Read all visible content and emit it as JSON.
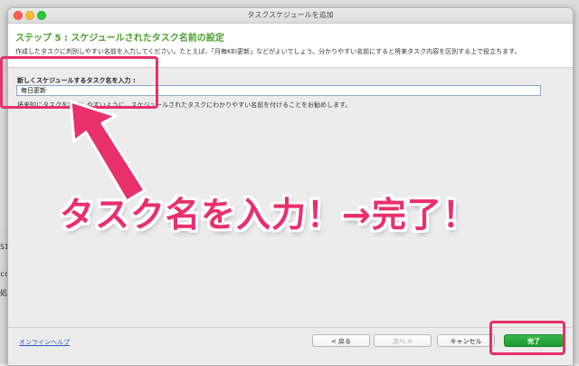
{
  "window": {
    "title": "タスクスケジュールを追加"
  },
  "header": {
    "step_title": "ステップ 5 : スケジュールされたタスク名前の設定",
    "description": "作成したタスクに判別しやすい名前を入力してください。たとえば、「月毎KEI更新」などがよいでしょう。分かりやすい名前にすると将来タスク内容を区別する上で役立ちます。"
  },
  "form": {
    "label": "新しくスケジュールするタスク名を入力 :",
    "task_name_value": "毎日更新",
    "hint": "将来的にタスクを判別しやすいように、スケジュールされたタスクにわかりやすい名前を付けることをお勧めします。"
  },
  "annotation": {
    "text": "タスク名を入力！→完了！",
    "color": "#e8306a"
  },
  "footer": {
    "help_link": "オンラインヘルプ",
    "back_label": "< 戻る",
    "next_label": "次へ >",
    "cancel_label": "キャンセル",
    "finish_label": "完了"
  },
  "background_side": {
    "line1": "SI",
    "line2": "cc",
    "line3": "処"
  },
  "colors": {
    "accent": "#4aa02c",
    "finish_button": "#28a83b",
    "highlight": "#e8306a"
  }
}
